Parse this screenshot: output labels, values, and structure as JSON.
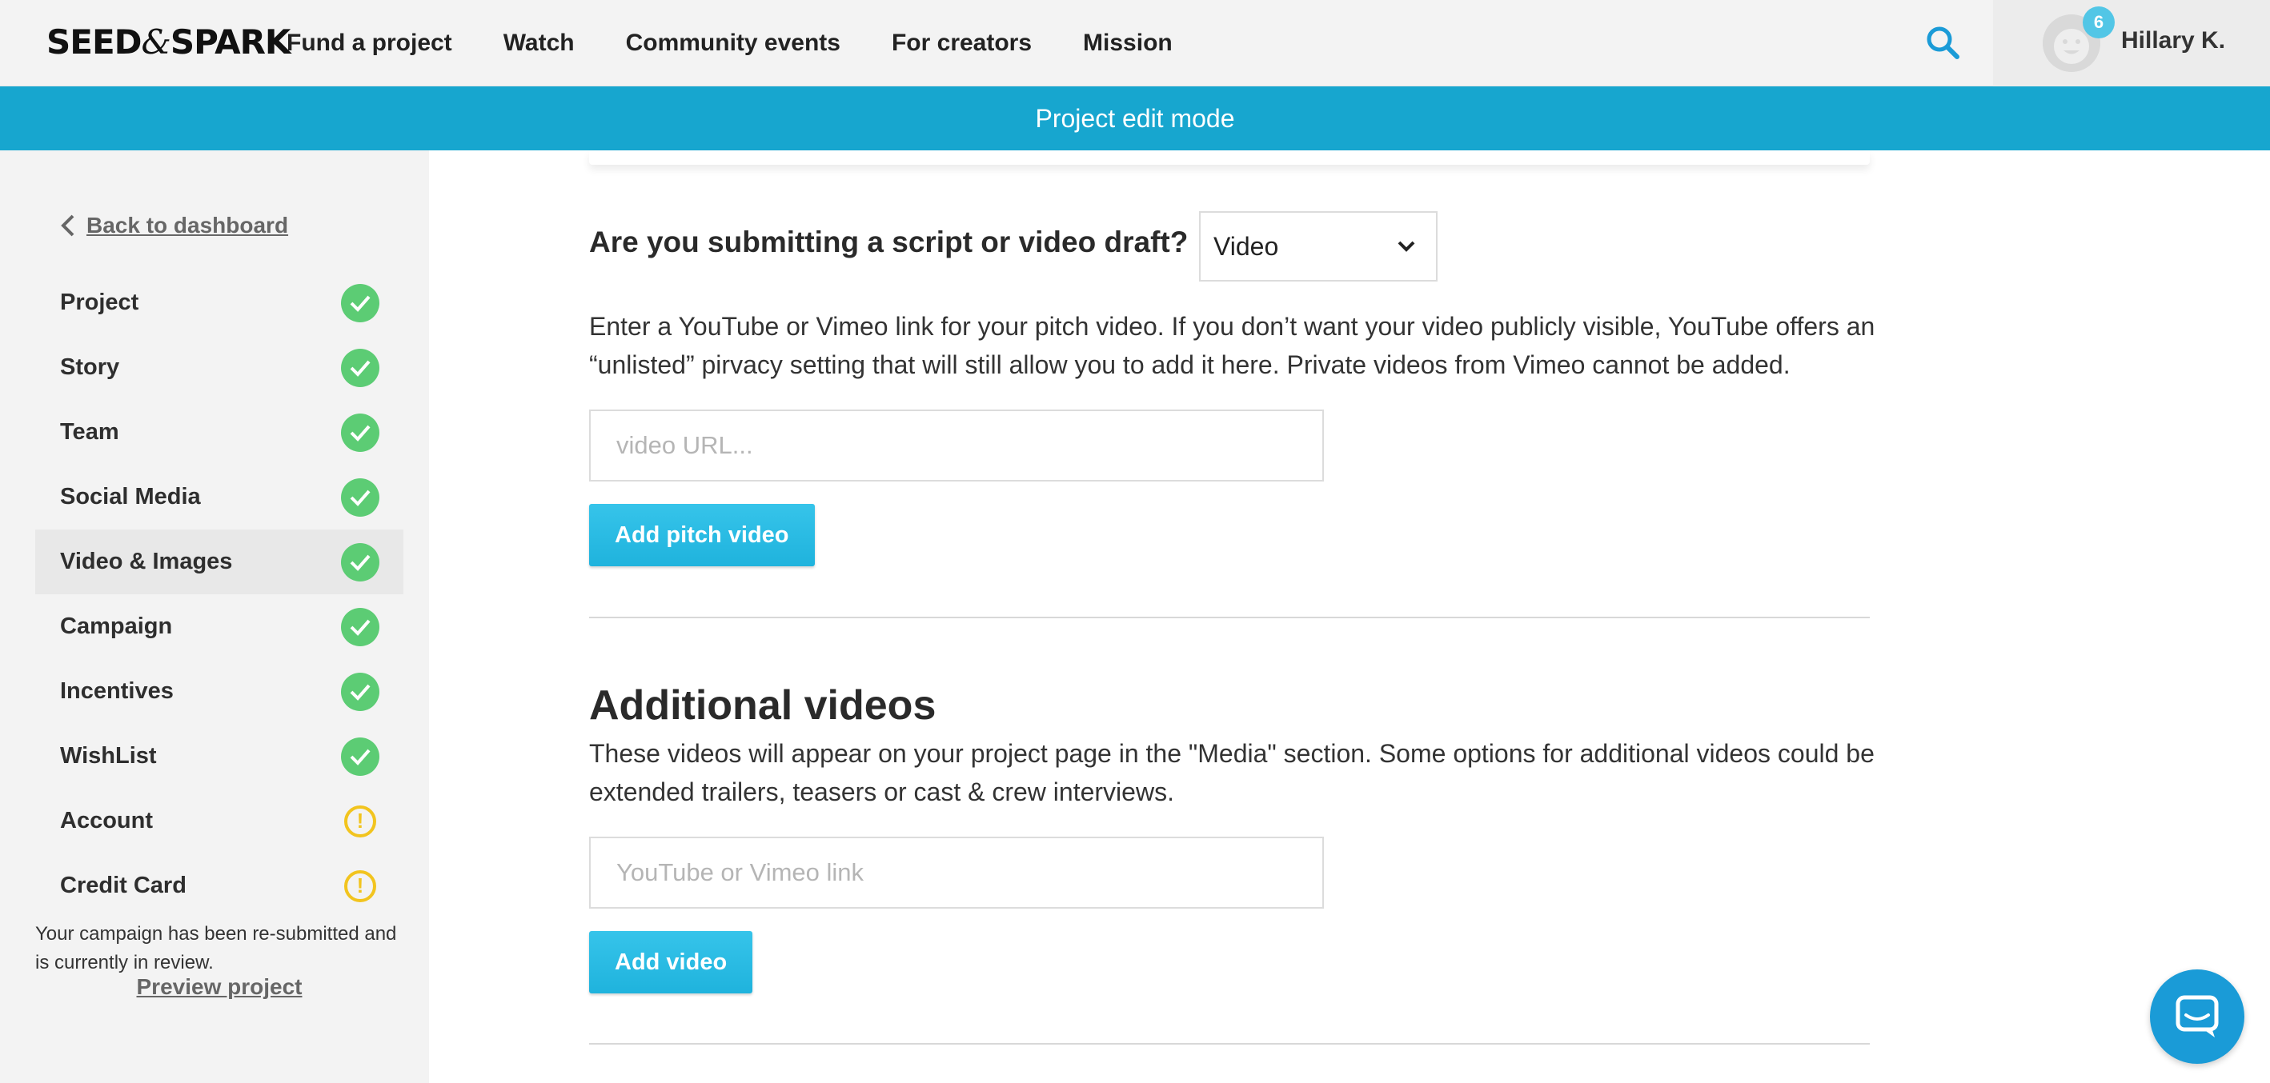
{
  "header": {
    "logo_text_left": "SEED",
    "logo_amp": "&",
    "logo_text_right": "SPARK",
    "nav": [
      {
        "label": "Fund a project"
      },
      {
        "label": "Watch"
      },
      {
        "label": "Community events"
      },
      {
        "label": "For creators"
      },
      {
        "label": "Mission"
      }
    ],
    "notification_count": "6",
    "username": "Hillary K."
  },
  "banner": {
    "text": "Project edit mode"
  },
  "sidebar": {
    "back_label": "Back to dashboard",
    "items": [
      {
        "label": "Project",
        "status": "complete"
      },
      {
        "label": "Story",
        "status": "complete"
      },
      {
        "label": "Team",
        "status": "complete"
      },
      {
        "label": "Social Media",
        "status": "complete"
      },
      {
        "label": "Video & Images",
        "status": "complete",
        "active": true
      },
      {
        "label": "Campaign",
        "status": "complete"
      },
      {
        "label": "Incentives",
        "status": "complete"
      },
      {
        "label": "WishList",
        "status": "complete"
      },
      {
        "label": "Account",
        "status": "warning"
      },
      {
        "label": "Credit Card",
        "status": "warning"
      }
    ],
    "note": "Your campaign has been re-submitted and is currently in review.",
    "preview_label": "Preview project"
  },
  "main": {
    "pitch": {
      "question": "Are you submitting a script or video draft?",
      "select_value": "Video",
      "description": "Enter a YouTube or Vimeo link for your pitch video. If you don’t want your video publicly visible, YouTube offers an “unlisted” pirvacy setting that will still allow you to add it here. Private videos from Vimeo cannot be added.",
      "input_placeholder": "video URL...",
      "button_label": "Add pitch video"
    },
    "additional": {
      "title": "Additional videos",
      "description": "These videos will appear on your project page in the \"Media\" section. Some options for additional videos could be extended trailers, teasers or cast & crew interviews.",
      "input_placeholder": "YouTube or Vimeo link",
      "button_label": "Add video"
    }
  },
  "colors": {
    "accent": "#17a6cf",
    "button": "#1fb3dd",
    "complete": "#5ccc74",
    "warning": "#f2c41e",
    "chat": "#1a9bd7"
  },
  "icons": {
    "search": "search-icon",
    "back": "chevron-left-icon",
    "select": "chevron-down-icon",
    "complete": "check-circle-icon",
    "warning": "exclamation-circle-icon",
    "chat": "chat-bubble-icon"
  }
}
